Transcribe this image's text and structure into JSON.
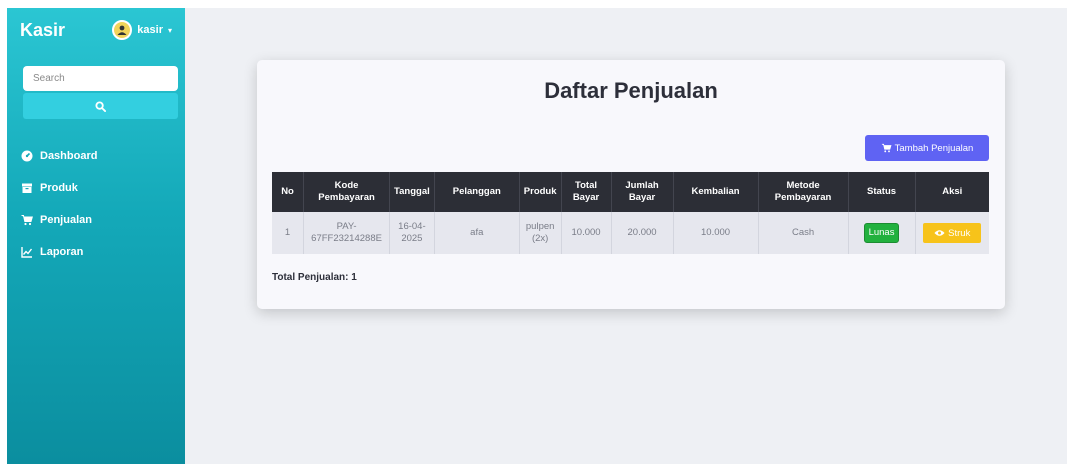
{
  "sidebar": {
    "brand": "Kasir",
    "user": "kasir",
    "search_placeholder": "Search",
    "items": [
      {
        "label": "Dashboard",
        "icon": "tachometer-icon"
      },
      {
        "label": "Produk",
        "icon": "box-icon"
      },
      {
        "label": "Penjualan",
        "icon": "cart-icon"
      },
      {
        "label": "Laporan",
        "icon": "chart-line-icon"
      }
    ]
  },
  "main": {
    "title": "Daftar Penjualan",
    "add_button": "Tambah Penjualan",
    "table": {
      "headers": [
        "No",
        "Kode Pembayaran",
        "Tanggal",
        "Pelanggan",
        "Produk",
        "Total Bayar",
        "Jumlah Bayar",
        "Kembalian",
        "Metode Pembayaran",
        "Status",
        "Aksi"
      ],
      "rows": [
        {
          "no": "1",
          "kode": "PAY-67FF23214288E",
          "tanggal": "16-04-2025",
          "pelanggan": "afa",
          "produk": "pulpen (2x)",
          "total_bayar": "10.000",
          "jumlah_bayar": "20.000",
          "kembalian": "10.000",
          "metode": "Cash",
          "status": "Lunas",
          "aksi": "Struk"
        }
      ]
    },
    "total_label": "Total Penjualan: 1"
  },
  "colors": {
    "sidebar_top": "#2bc6d3",
    "sidebar_bottom": "#0b8e9f",
    "add_button": "#5f63f3",
    "table_header": "#2c2e36",
    "status_badge": "#22b13e",
    "struk_button": "#f7c31a"
  }
}
